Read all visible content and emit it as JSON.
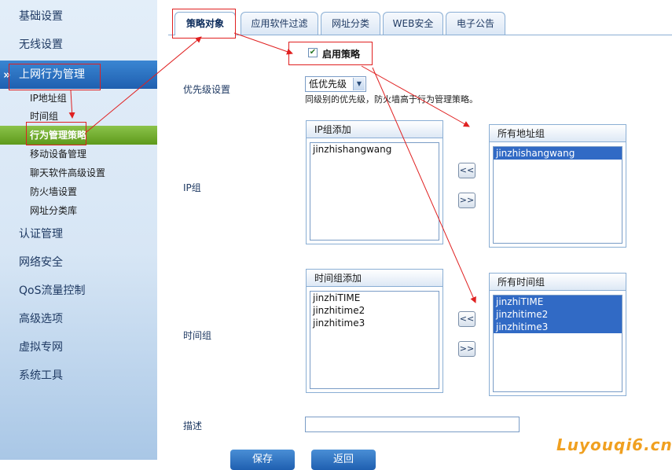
{
  "sidebar": {
    "items_top": [
      {
        "label": "基础设置"
      },
      {
        "label": "无线设置"
      },
      {
        "label": "上网行为管理"
      }
    ],
    "sub_items": [
      {
        "label": "IP地址组"
      },
      {
        "label": "时间组"
      },
      {
        "label": "行为管理策略"
      },
      {
        "label": "移动设备管理"
      },
      {
        "label": "聊天软件高级设置"
      },
      {
        "label": "防火墙设置"
      },
      {
        "label": "网址分类库"
      }
    ],
    "items_bottom": [
      {
        "label": "认证管理"
      },
      {
        "label": "网络安全"
      },
      {
        "label": "QoS流量控制"
      },
      {
        "label": "高级选项"
      },
      {
        "label": "虚拟专网"
      },
      {
        "label": "系统工具"
      }
    ]
  },
  "tabs": [
    {
      "label": "策略对象"
    },
    {
      "label": "应用软件过滤"
    },
    {
      "label": "网址分类"
    },
    {
      "label": "WEB安全"
    },
    {
      "label": "电子公告"
    }
  ],
  "form": {
    "enable_label": "启用策略",
    "enable_checked": true,
    "priority_label": "优先级设置",
    "priority_value": "低优先级",
    "priority_hint": "同级别的优先级，防火墙高于行为管理策略。",
    "ip_group_label": "IP组",
    "ip_added_title": "IP组添加",
    "ip_added_items": [
      "jinzhishangwang"
    ],
    "ip_all_title": "所有地址组",
    "ip_all_items": [
      "jinzhishangwang"
    ],
    "time_group_label": "时间组",
    "time_added_title": "时间组添加",
    "time_added_items": [
      "jinzhiTIME",
      "jinzhitime2",
      "jinzhitime3"
    ],
    "time_all_title": "所有时间组",
    "time_all_items": [
      "jinzhiTIME",
      "jinzhitime2",
      "jinzhitime3"
    ],
    "move_left": "<<",
    "move_right": ">>",
    "desc_label": "描述",
    "desc_value": "",
    "save_label": "保存",
    "back_label": "返回"
  },
  "watermark": "Luyouqi6.cn",
  "colors": {
    "sidebar_active": "#1f5fb0",
    "sub_active": "#5e9a1c",
    "selection": "#316ac5",
    "annotation": "#e02020"
  }
}
